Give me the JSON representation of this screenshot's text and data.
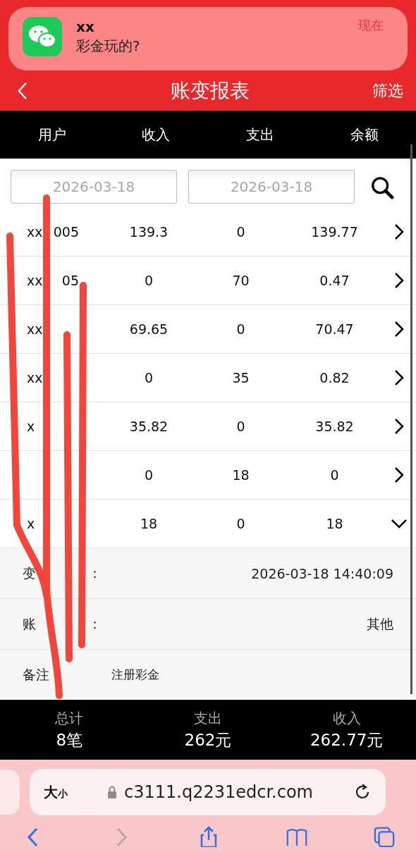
{
  "notification": {
    "sender": "xx",
    "message": "彩金玩的?",
    "time": "现在"
  },
  "header": {
    "title": "账变报表",
    "filter": "筛选"
  },
  "columns": [
    "用户",
    "收入",
    "支出",
    "余额"
  ],
  "date_filters": [
    {
      "placeholder": "2026-03-18"
    },
    {
      "placeholder": "2026-03-18"
    }
  ],
  "rows": [
    {
      "user_head": "xx",
      "user_tail": "005",
      "income": "139.3",
      "expense": "0",
      "balance": "139.77",
      "expanded": false
    },
    {
      "user_head": "xx",
      "user_tail": "05",
      "income": "0",
      "expense": "70",
      "balance": "0.47",
      "expanded": false
    },
    {
      "user_head": "xx",
      "income": "69.65",
      "expense": "0",
      "balance": "70.47",
      "expanded": false
    },
    {
      "user_head": "xx",
      "income": "0",
      "expense": "35",
      "balance": "0.82",
      "expanded": false
    },
    {
      "user_head": "x",
      "income": "35.82",
      "expense": "0",
      "balance": "35.82",
      "expanded": false
    },
    {
      "income": "0",
      "expense": "18",
      "balance": "0",
      "expanded": false
    },
    {
      "user_head": "x",
      "income": "18",
      "expense": "0",
      "balance": "18",
      "expanded": true
    }
  ],
  "details": [
    {
      "kind": "field",
      "label": "变",
      "label_tail": "：",
      "value": "2026-03-18 14:40:09"
    },
    {
      "kind": "field",
      "label": "账",
      "label_tail": "：",
      "value": "其他"
    },
    {
      "kind": "remark",
      "label": "备注",
      "value": "注册彩金"
    }
  ],
  "totals": [
    {
      "label": "总计",
      "value": "8笔"
    },
    {
      "label": "支出",
      "value": "262元"
    },
    {
      "label": "收入",
      "value": "262.77元"
    }
  ],
  "browser": {
    "text_size_big": "大",
    "text_size_small": "小",
    "url": "c3111.q2231edcr.com"
  }
}
